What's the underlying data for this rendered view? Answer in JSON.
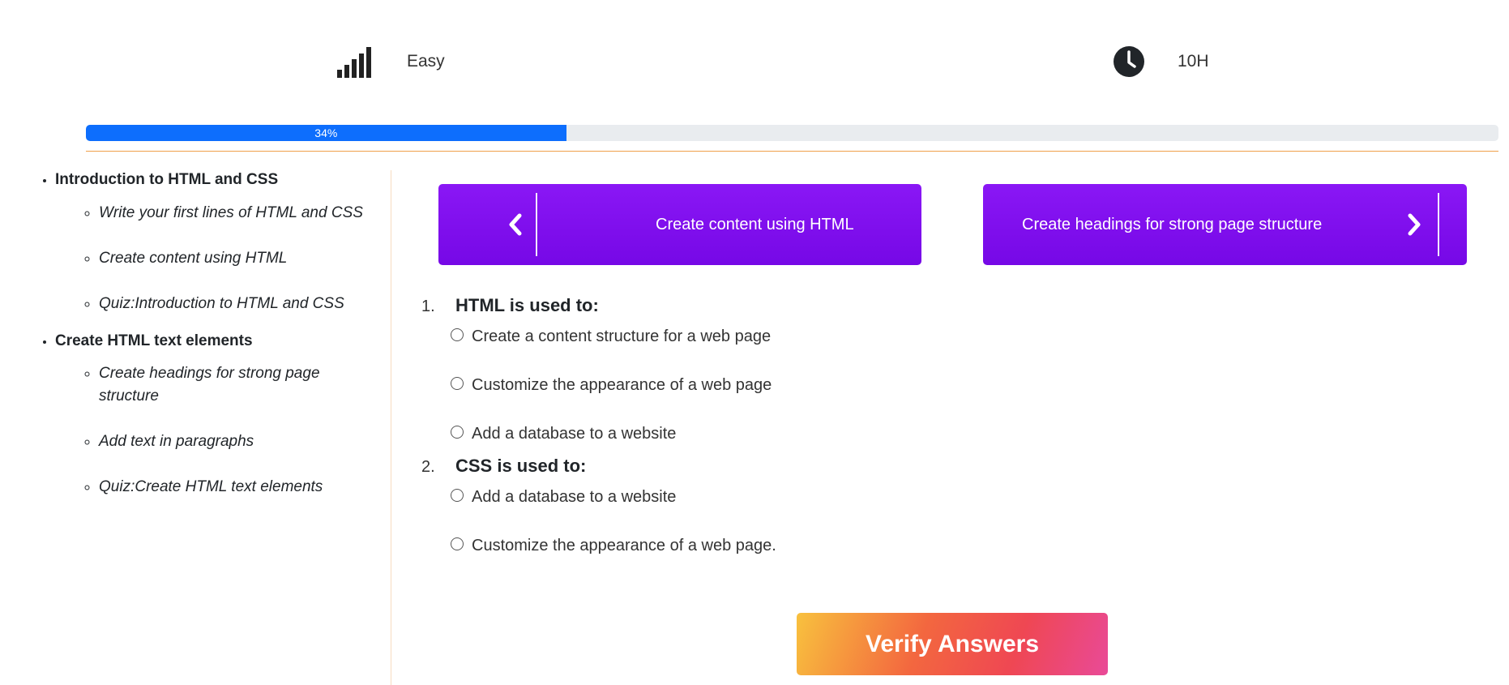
{
  "stats": {
    "difficulty": {
      "icon": "signal-bars-icon",
      "label": "Easy"
    },
    "duration": {
      "icon": "clock-icon",
      "label": "10H"
    }
  },
  "progress": {
    "value": 0.34,
    "label": "34%",
    "color": "#0d6efd"
  },
  "sidebar": {
    "sections": [
      {
        "title": "Introduction to HTML and CSS",
        "lessons": [
          "Write your first lines of HTML and CSS",
          "Create content using HTML",
          "Quiz:Introduction to HTML and CSS"
        ]
      },
      {
        "title": "Create HTML text elements",
        "lessons": [
          "Create headings for strong page structure",
          "Add text in paragraphs",
          "Quiz:Create HTML text elements"
        ]
      }
    ]
  },
  "nav": {
    "prev": {
      "label": "Create content using HTML",
      "icon": "chevron-left-icon"
    },
    "next": {
      "label": "Create headings for strong page structure",
      "icon": "chevron-right-icon"
    },
    "color": "#7c0ff0"
  },
  "quiz": {
    "questions": [
      {
        "number": "1.",
        "text": "HTML is used to:",
        "options": [
          "Create a content structure for a web page",
          "Customize the appearance of a web page",
          "Add a database to a website"
        ]
      },
      {
        "number": "2.",
        "text": "CSS is used to:",
        "options": [
          "Add a database to a website",
          "Customize the appearance of a web page."
        ]
      }
    ],
    "verify_label": "Verify Answers"
  }
}
